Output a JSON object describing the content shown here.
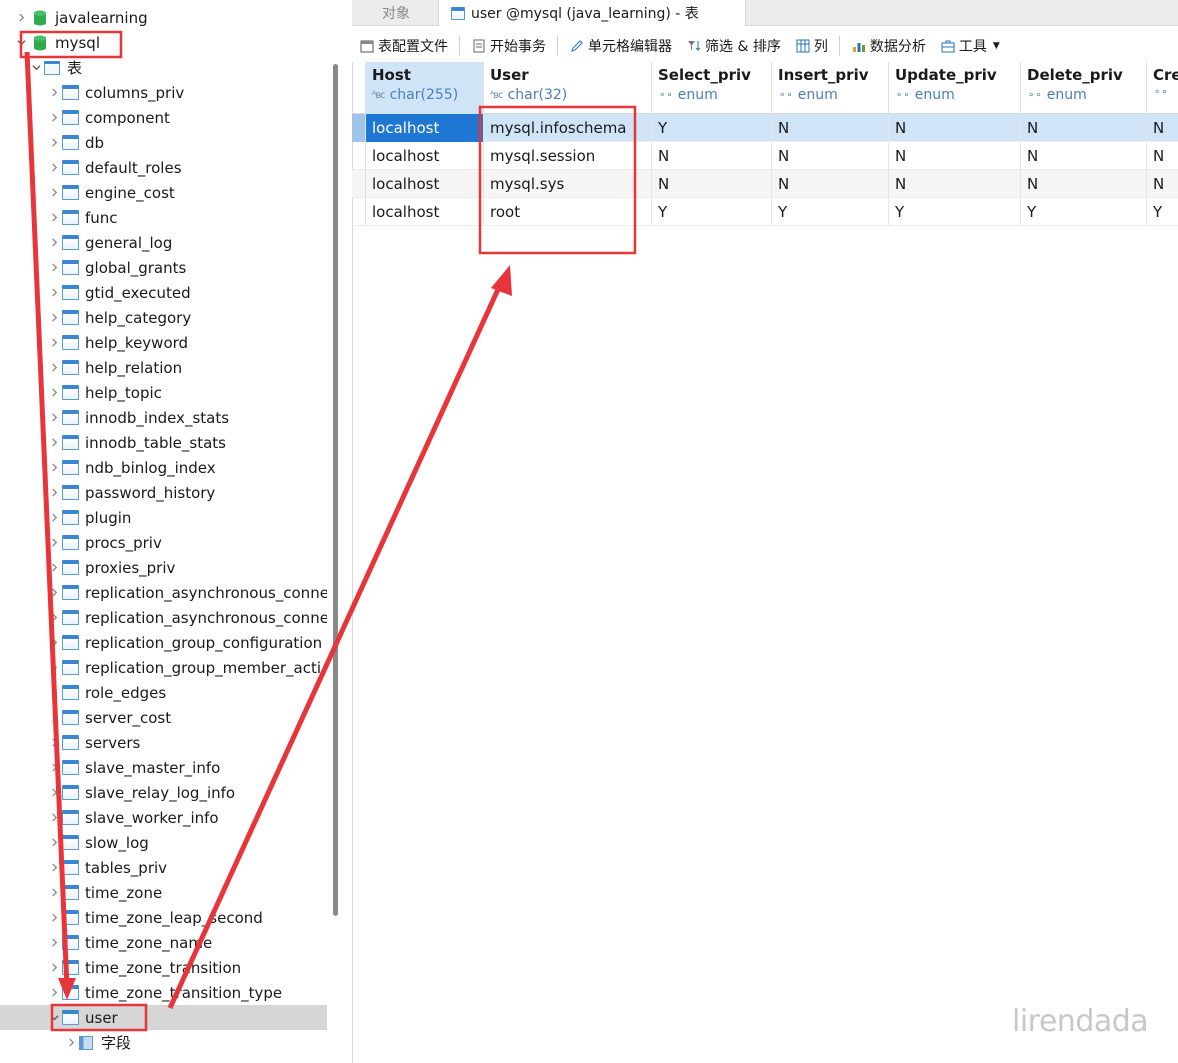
{
  "tree": {
    "databases": [
      {
        "name": "javalearning",
        "expanded": false
      },
      {
        "name": "mysql",
        "expanded": true
      }
    ],
    "tables_group_label": "表",
    "tables": [
      "columns_priv",
      "component",
      "db",
      "default_roles",
      "engine_cost",
      "func",
      "general_log",
      "global_grants",
      "gtid_executed",
      "help_category",
      "help_keyword",
      "help_relation",
      "help_topic",
      "innodb_index_stats",
      "innodb_table_stats",
      "ndb_binlog_index",
      "password_history",
      "plugin",
      "procs_priv",
      "proxies_priv",
      "replication_asynchronous_conne",
      "replication_asynchronous_conne",
      "replication_group_configuration",
      "replication_group_member_acti",
      "role_edges",
      "server_cost",
      "servers",
      "slave_master_info",
      "slave_relay_log_info",
      "slave_worker_info",
      "slow_log",
      "tables_priv",
      "time_zone",
      "time_zone_leap_second",
      "time_zone_name",
      "time_zone_transition",
      "time_zone_transition_type",
      "user"
    ],
    "selected_table": "user",
    "child_fields_label": "字段"
  },
  "tabs": {
    "objects_label": "对象",
    "active_label": "user @mysql (java_learning) - 表"
  },
  "toolbar": {
    "config_file": "表配置文件",
    "begin_transaction": "开始事务",
    "cell_editor": "单元格编辑器",
    "filter_sort": "筛选 & 排序",
    "columns": "列",
    "data_analysis": "数据分析",
    "tools": "工具"
  },
  "grid": {
    "columns": [
      {
        "name": "Host",
        "type": "char(255)",
        "type_icon": "text-type-icon"
      },
      {
        "name": "User",
        "type": "char(32)",
        "type_icon": "text-type-icon"
      },
      {
        "name": "Select_priv",
        "type": "enum",
        "type_icon": "enum-type-icon"
      },
      {
        "name": "Insert_priv",
        "type": "enum",
        "type_icon": "enum-type-icon"
      },
      {
        "name": "Update_priv",
        "type": "enum",
        "type_icon": "enum-type-icon"
      },
      {
        "name": "Delete_priv",
        "type": "enum",
        "type_icon": "enum-type-icon"
      },
      {
        "name": "Cre",
        "type": "",
        "type_icon": "enum-type-icon"
      }
    ],
    "rows": [
      [
        "localhost",
        "mysql.infoschema",
        "Y",
        "N",
        "N",
        "N",
        "N"
      ],
      [
        "localhost",
        "mysql.session",
        "N",
        "N",
        "N",
        "N",
        "N"
      ],
      [
        "localhost",
        "mysql.sys",
        "N",
        "N",
        "N",
        "N",
        "N"
      ],
      [
        "localhost",
        "root",
        "Y",
        "Y",
        "Y",
        "Y",
        "Y"
      ]
    ],
    "selected_row": 0
  },
  "watermark": "lirendada",
  "colors": {
    "annotation": "#e8353a",
    "selection": "#1e77d3",
    "db_icon": "#2faa4f",
    "table_icon": "#3b86d4"
  }
}
